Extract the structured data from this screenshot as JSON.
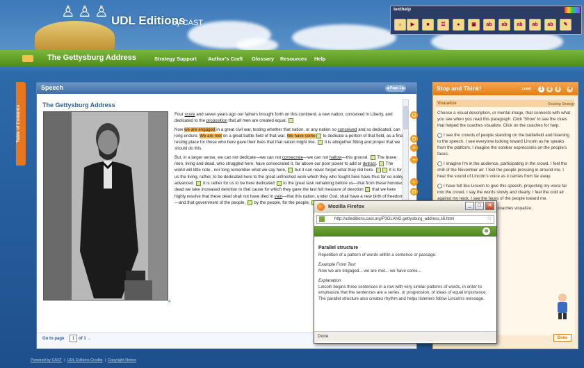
{
  "header": {
    "logo_title": "UDL Editions",
    "logo_by": "by CAST"
  },
  "nav": {
    "title": "The Gettysburg Address",
    "links": [
      "Strategy Support",
      "Author's Craft",
      "Glossary",
      "Resources",
      "Help"
    ]
  },
  "texthelp": {
    "title": "texthelp",
    "buttons": [
      "☼",
      "▶",
      "■",
      "☰",
      "●",
      "▣",
      "ab",
      "ab",
      "ab",
      "ab",
      "ab",
      "✎"
    ]
  },
  "toc": {
    "label": "Table of Contents"
  },
  "main": {
    "header": "Speech",
    "page_pill": "◀ Page 1 ▶",
    "doc_title": "The Gettysburg Address",
    "photo_caption_num": "4",
    "goto_label": "Go to page",
    "goto_value": "1",
    "goto_of": "of 1 →",
    "paragraphs": [
      [
        {
          "t": "Four "
        },
        {
          "t": "score",
          "c": "u"
        },
        {
          "t": " and seven years ago our fathers brought forth on this continent, a new nation, conceived in Liberty, and dedicated to the "
        },
        {
          "t": "proposition",
          "c": "u"
        },
        {
          "t": " that all men are created equal. "
        },
        {
          "n": 1
        }
      ],
      [
        {
          "t": "Now "
        },
        {
          "t": "we are engaged",
          "c": "hl"
        },
        {
          "t": " in a great civil war, testing whether that nation, or any nation so "
        },
        {
          "t": "conceived",
          "c": "u"
        },
        {
          "t": " and so dedicated, can long endure. "
        },
        {
          "t": "We are met",
          "c": "hl"
        },
        {
          "t": " on a great battle-field of that war. "
        },
        {
          "t": "We have come",
          "c": "hl"
        },
        {
          "n": 1
        },
        {
          "t": " to dedicate a portion of that field, as a final resting place for those who here gave their lives that that nation might live. "
        },
        {
          "n": 1
        },
        {
          "t": " It is altogether fitting and proper that we should do this."
        }
      ],
      [
        {
          "t": "But, in a larger sense, we can not dedicate—we can not "
        },
        {
          "t": "consecrate",
          "c": "u"
        },
        {
          "t": "—we can not "
        },
        {
          "t": "hallow",
          "c": "u"
        },
        {
          "t": "—this ground. "
        },
        {
          "n": 1
        },
        {
          "t": " The brave men, living and dead, who struggled here, have consecrated it, far above our poor power to add or "
        },
        {
          "t": "detract",
          "c": "u"
        },
        {
          "t": ". "
        },
        {
          "n": 1
        },
        {
          "t": " The world will little note , nor long remember what we say here, "
        },
        {
          "n": 1
        },
        {
          "t": " but it can never forget what they did here. "
        },
        {
          "n": 1
        },
        {
          "n": 1
        },
        {
          "t": " It is for us the living, rather, to be dedicated here to the great unfinished work which they who fought here have thus far so nobly advanced. "
        },
        {
          "n": 1
        },
        {
          "t": " It is rather for us to be here dedicated "
        },
        {
          "n": 1
        },
        {
          "t": " to the great task remaining before us—that from these honored dead we take increased devotion to that cause for which they gave the last full measure of devotion "
        },
        {
          "n": 1
        },
        {
          "t": " that we here highly resolve that these dead shall not have died in "
        },
        {
          "t": "vain",
          "c": "u"
        },
        {
          "t": "—that this nation, under God, shall have a new birth of freedom—and that government of the people, "
        },
        {
          "n": 1
        },
        {
          "t": " by the people, for the people, "
        },
        {
          "n": 1
        },
        {
          "n": 1
        },
        {
          "t": " shall not perish from the earth."
        }
      ]
    ]
  },
  "side": {
    "header": "Stop and Think!",
    "level_label": "Level",
    "levels": [
      "1",
      "2",
      "3",
      "4"
    ],
    "section": "Visualize",
    "reading_strategy": "Reading Strategy",
    "intro": "Choose a visual description, or mental image, that connects with what you see when you read this paragraph. Click 'Show' to see the clues that helped the coaches visualize. Click on the coaches for help.",
    "option1": "I see the crowds of people standing on the battlefield and listening to the speech. I see everyone looking toward Lincoln as he speaks from the platform. I imagine the somber expressions on the people's faces.",
    "option2": "I imagine I'm in the audience, participating in the crowd. I feel the chill of the November air. I feel the people pressing in around me. I hear the sound of Lincoln's voice as it carries from far away.",
    "option3": "I have felt like Lincoln to give this speech, projecting my voice far into the crowd. I say the words slowly and clearly. I feel the cold air against my neck. I see the faces of the people toward me.",
    "clues_text": "Show the clues that helped the coaches visualize.",
    "help_text": "Help.",
    "done": "Done"
  },
  "popup": {
    "window_title": "Mozilla Firefox",
    "url": "http://udleditions.cast.org/P3GLANG,gettysburg_address,s6.html",
    "term": "Parallel structure",
    "definition": "Repetition of a pattern of words within a sentence or passage.",
    "example_label": "Example From Text",
    "example": "Now we are engaged... we are met... we have come...",
    "explanation_label": "Explanation",
    "explanation": "Lincoln begins three sentences in a row with very similar patterns of words, in order to emphasize that the sentences are a series, or progression, of ideas of equal importance. The parallel structure also creates rhythm and helps listeners follow Lincoln's message.",
    "status": "Done"
  },
  "footer": {
    "links": [
      "Powered by CAST",
      "UDL Editions Credits",
      "Copyright Notice"
    ],
    "sep": "|"
  }
}
